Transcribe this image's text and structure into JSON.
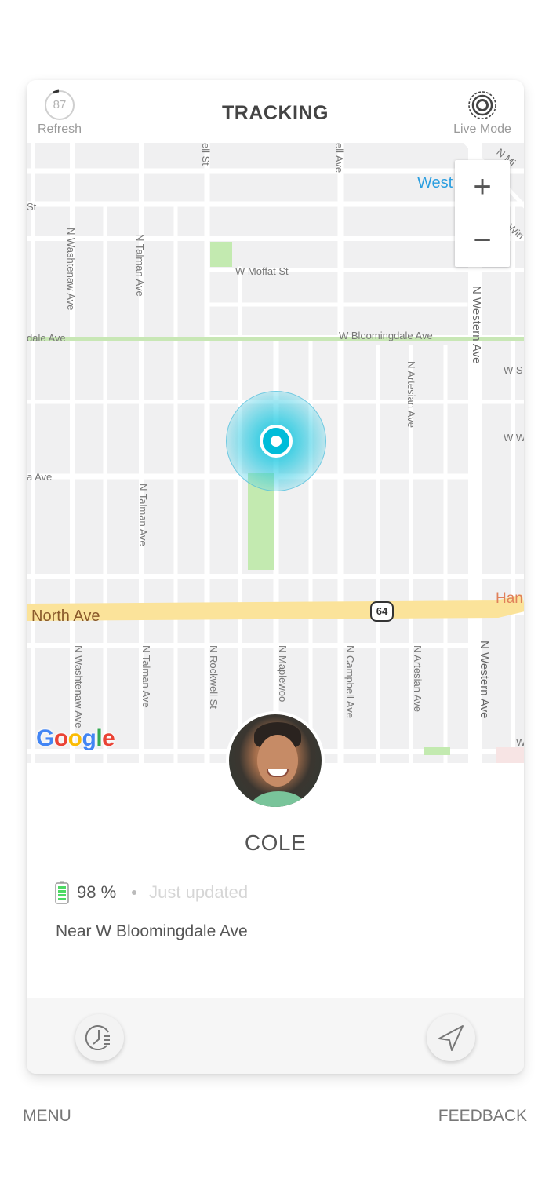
{
  "header": {
    "refresh_count": "87",
    "refresh_label": "Refresh",
    "title": "TRACKING",
    "live_mode_label": "Live Mode"
  },
  "map": {
    "zoom_in_label": "+",
    "zoom_out_label": "−",
    "labels": {
      "w_moffat": "W Moffat St",
      "w_bloomingdale": "W Bloomingdale Ave",
      "bloomingdale_partial": "dale Ave",
      "st_partial": "St",
      "ave_partial": "a Ave",
      "west": "West",
      "n_mi": "N Mi",
      "win": "Win",
      "w_s": "W S",
      "w_w": "W W",
      "ell_st": "ell St",
      "ell_ave": "ell Ave",
      "washtenaw_top": "N Washtenaw Ave",
      "talman_top": "N Talman Ave",
      "talman_mid": "N Talman Ave",
      "artesian_mid": "N Artesian Ave",
      "western_top": "N Western Ave",
      "north_ave": "North Ave",
      "route_64": "64",
      "han": "Han",
      "washtenaw_bot": "N Washtenaw Ave",
      "talman_bot": "N Talman Ave",
      "rockwell_bot": "N Rockwell St",
      "maplewood_bot": "N Maplewoo",
      "campbell_bot": "N Campbell Ave",
      "artesian_bot": "N Artesian Ave",
      "western_bot": "N Western Ave",
      "w_partial": "W"
    },
    "attribution": {
      "letters": [
        "G",
        "o",
        "o",
        "g",
        "l",
        "e"
      ],
      "colors": [
        "#4285F4",
        "#EA4335",
        "#FBBC05",
        "#4285F4",
        "#34A853",
        "#EA4335"
      ]
    }
  },
  "profile": {
    "name": "COLE",
    "battery_percent": "98 %",
    "battery_level": 0.98,
    "updated": "Just updated",
    "address": "Near W Bloomingdale Ave"
  },
  "colors": {
    "accent": "#00bcd9",
    "battery_green": "#4cd964",
    "map_bg": "#f0f0f1",
    "major_road": "#fbe39a",
    "park": "#c3eab0"
  },
  "footer": {
    "menu_label": "MENU",
    "feedback_label": "FEEDBACK"
  }
}
